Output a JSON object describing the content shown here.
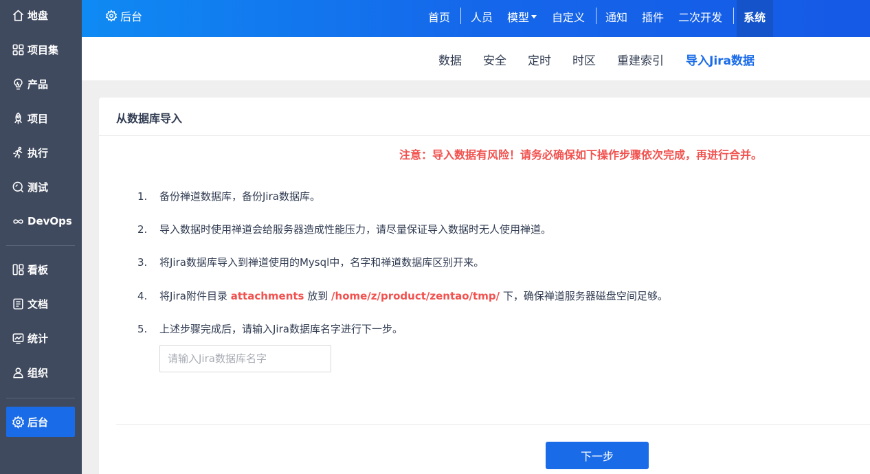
{
  "sidebar": {
    "items": [
      {
        "label": "地盘",
        "icon": "home-icon"
      },
      {
        "label": "项目集",
        "icon": "grid-icon"
      },
      {
        "label": "产品",
        "icon": "lightbulb-icon"
      },
      {
        "label": "项目",
        "icon": "rocket-icon"
      },
      {
        "label": "执行",
        "icon": "run-icon"
      },
      {
        "label": "测试",
        "icon": "search-bug-icon"
      },
      {
        "label": "DevOps",
        "icon": "infinity-icon"
      },
      {
        "label": "看板",
        "icon": "kanban-icon"
      },
      {
        "label": "文档",
        "icon": "document-icon"
      },
      {
        "label": "统计",
        "icon": "chart-icon"
      },
      {
        "label": "组织",
        "icon": "user-icon"
      },
      {
        "label": "后台",
        "icon": "gear-icon",
        "active": true
      }
    ]
  },
  "topbar": {
    "brand": "后台",
    "nav": [
      "首页",
      "人员",
      "模型",
      "自定义",
      "通知",
      "插件",
      "二次开发",
      "系统"
    ],
    "active": "系统"
  },
  "subnav": {
    "items": [
      "数据",
      "安全",
      "定时",
      "时区",
      "重建索引",
      "导入Jira数据"
    ],
    "active": "导入Jira数据"
  },
  "panel": {
    "title": "从数据库导入",
    "warning": "注意：导入数据有风险！请务必确保如下操作步骤依次完成，再进行合并。",
    "steps": [
      {
        "num": "1.",
        "text": "备份禅道数据库，备份Jira数据库。"
      },
      {
        "num": "2.",
        "text": "导入数据时使用禅道会给服务器造成性能压力，请尽量保证导入数据时无人使用禅道。"
      },
      {
        "num": "3.",
        "text": "将Jira数据库导入到禅道使用的Mysql中，名字和禅道数据库区别开来。"
      },
      {
        "num": "4.",
        "pre": "将Jira附件目录 ",
        "hl1": "attachments",
        "mid": " 放到 ",
        "hl2": "/home/z/product/zentao/tmp/",
        "post": " 下，确保禅道服务器磁盘空间足够。"
      },
      {
        "num": "5.",
        "text": "上述步骤完成后，请输入Jira数据库名字进行下一步。"
      }
    ],
    "input_placeholder": "请输入Jira数据库名字",
    "input_value": "",
    "next_label": "下一步"
  },
  "colors": {
    "sidebar_bg": "#404a5e",
    "accent": "#1a6be8",
    "warning": "#f1524f"
  }
}
